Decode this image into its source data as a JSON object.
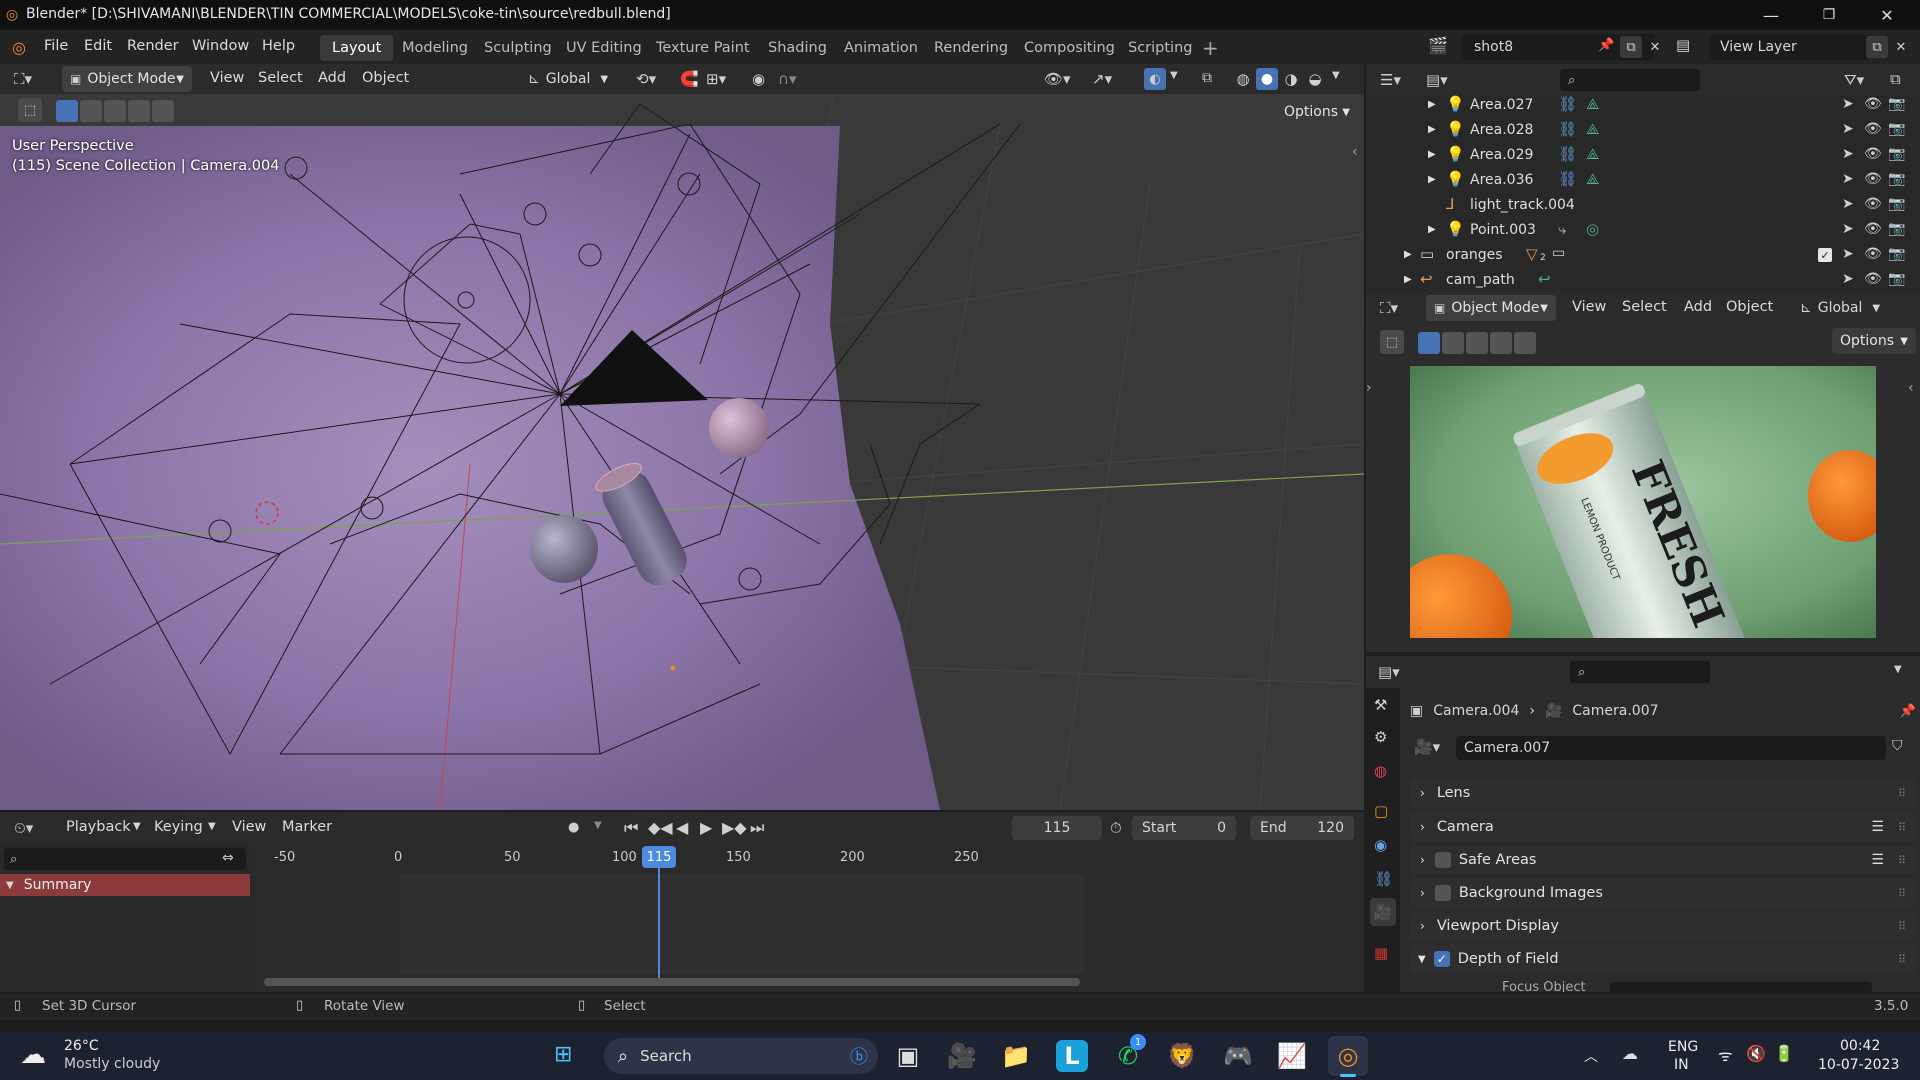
{
  "window": {
    "title": "Blender* [D:\\SHIVAMANI\\BLENDER\\TIN COMMERCIAL\\MODELS\\coke-tin\\source\\redbull.blend]"
  },
  "menu": [
    "File",
    "Edit",
    "Render",
    "Window",
    "Help"
  ],
  "workspaces": [
    "Layout",
    "Modeling",
    "Sculpting",
    "UV Editing",
    "Texture Paint",
    "Shading",
    "Animation",
    "Rendering",
    "Compositing",
    "Scripting"
  ],
  "scene": {
    "name": "shot8",
    "view_layer": "View Layer"
  },
  "viewport": {
    "mode": "Object Mode",
    "menus": [
      "View",
      "Select",
      "Add",
      "Object"
    ],
    "transform": "Global",
    "options": "Options",
    "overlay_title": "User Perspective",
    "overlay_sub": "(115) Scene Collection | Camera.004"
  },
  "outliner": {
    "items": [
      {
        "label": "Area.027"
      },
      {
        "label": "Area.028"
      },
      {
        "label": "Area.029"
      },
      {
        "label": "Area.036"
      },
      {
        "label": "light_track.004"
      },
      {
        "label": "Point.003"
      },
      {
        "label": "oranges",
        "badge": "2"
      },
      {
        "label": "cam_path"
      }
    ]
  },
  "preview": {
    "mode": "Object Mode",
    "menus": [
      "View",
      "Select",
      "Add",
      "Object"
    ],
    "transform": "Global",
    "options": "Options",
    "can_text": "FRESH",
    "can_subtext": "LEMON PRODUCT"
  },
  "properties": {
    "breadcrumb_object": "Camera.004",
    "breadcrumb_data": "Camera.007",
    "datablock": "Camera.007",
    "panels": [
      {
        "label": "Lens",
        "expanded": false
      },
      {
        "label": "Camera",
        "expanded": false
      },
      {
        "label": "Safe Areas",
        "expanded": false,
        "checkbox": false
      },
      {
        "label": "Background Images",
        "expanded": false,
        "checkbox": false
      },
      {
        "label": "Viewport Display",
        "expanded": false
      },
      {
        "label": "Depth of Field",
        "expanded": true,
        "checkbox": true
      }
    ],
    "cut_row": "Focus Object"
  },
  "timeline": {
    "menus": [
      "Playback",
      "Keying",
      "View",
      "Marker"
    ],
    "current_frame": "115",
    "start_label": "Start",
    "start": "0",
    "end_label": "End",
    "end": "120",
    "ruler": [
      "-50",
      "0",
      "50",
      "100",
      "115",
      "150",
      "200",
      "250"
    ],
    "summary": "Summary"
  },
  "status": {
    "set_cursor": "Set 3D Cursor",
    "rotate": "Rotate View",
    "select": "Select",
    "version": "3.5.0"
  },
  "taskbar": {
    "weather_temp": "26°C",
    "weather_desc": "Mostly cloudy",
    "search": "Search",
    "lang1": "ENG",
    "lang2": "IN",
    "time": "00:42",
    "date": "10-07-2023",
    "whatsapp_badge": "1"
  },
  "colors": {
    "accent": "#4772b3",
    "active_frame": "#4d8be0",
    "window_bg": "#1d1d1d",
    "backdrop": "#8a73a6",
    "grid": "#3d3d3d"
  }
}
